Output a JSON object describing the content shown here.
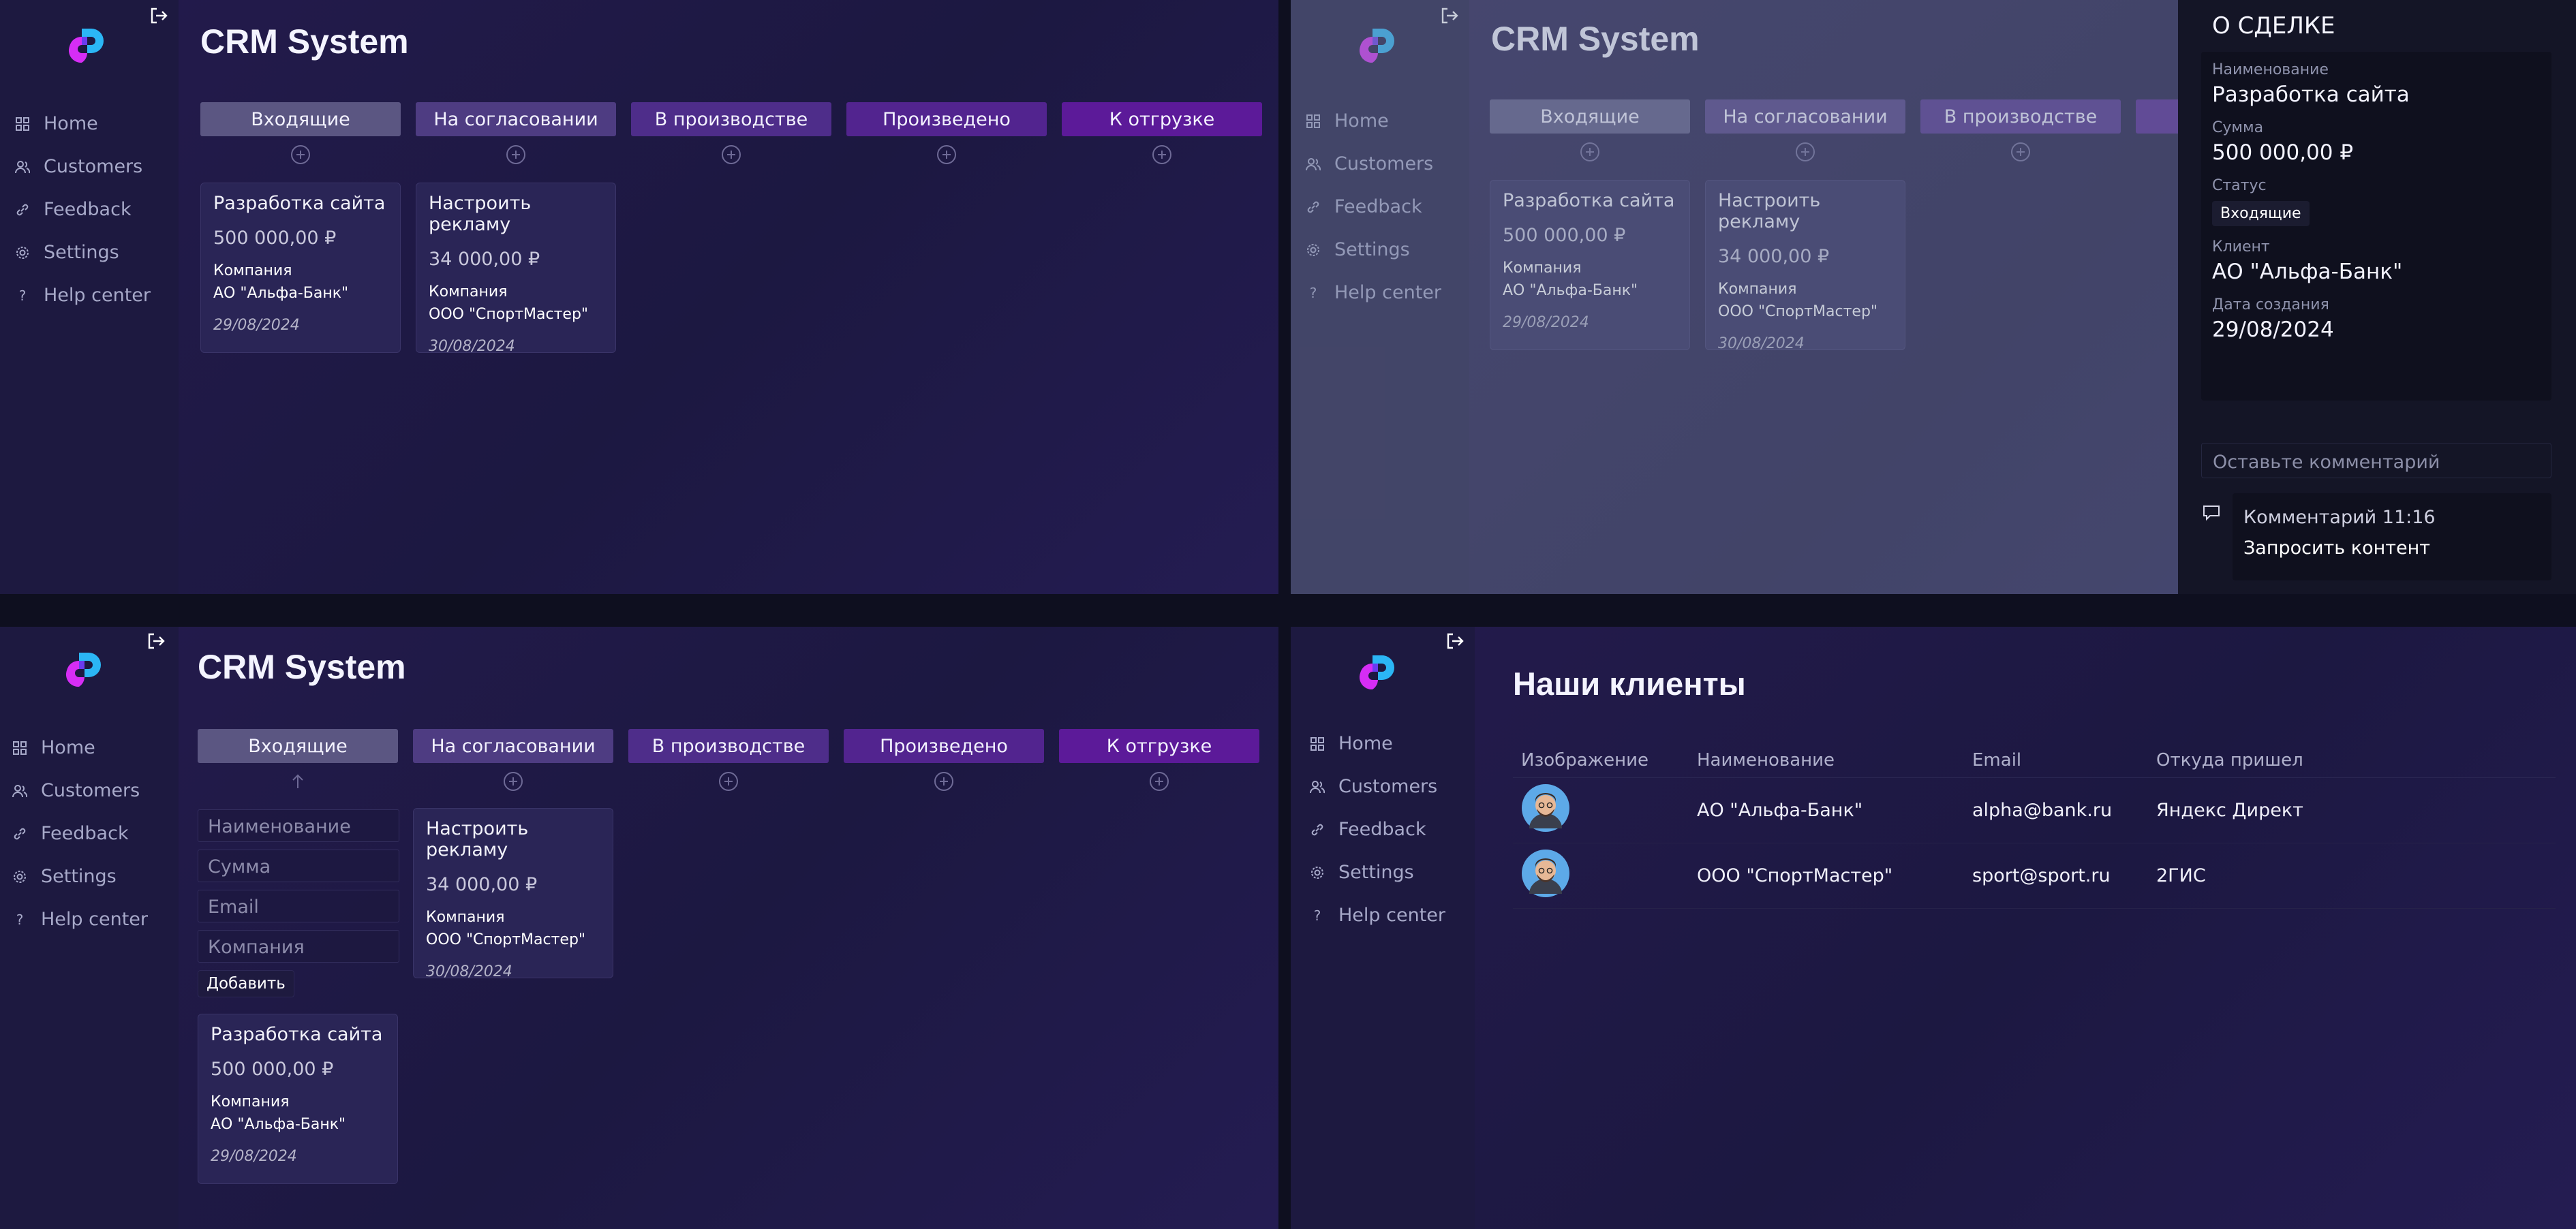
{
  "app": {
    "title": "CRM System",
    "nav": [
      {
        "label": "Home",
        "icon": "grid-icon"
      },
      {
        "label": "Customers",
        "icon": "users-icon"
      },
      {
        "label": "Feedback",
        "icon": "link-icon"
      },
      {
        "label": "Settings",
        "icon": "gear-icon"
      },
      {
        "label": "Help center",
        "icon": "question-icon"
      }
    ]
  },
  "board": {
    "columns": [
      {
        "label": "Входящие",
        "color": "#5b5682"
      },
      {
        "label": "На согласовании",
        "color": "#4e3c82"
      },
      {
        "label": "В производстве",
        "color": "#4e2d8a"
      },
      {
        "label": "Произведено",
        "color": "#52248f"
      },
      {
        "label": "К отгрузке",
        "color": "#5c1a99"
      }
    ],
    "deals": [
      {
        "title": "Разработка сайта",
        "sum": "500 000,00 ₽",
        "company_label": "Компания",
        "company": "АО \"Альфа-Банк\"",
        "date": "29/08/2024"
      },
      {
        "title": "Настроить рекламу",
        "sum": "34 000,00 ₽",
        "company_label": "Компания",
        "company": "ООО \"СпортМастер\"",
        "date": "30/08/2024"
      }
    ]
  },
  "drawer": {
    "title": "О СДЕЛКЕ",
    "name_label": "Наименование",
    "name": "Разработка сайта",
    "sum_label": "Сумма",
    "sum": "500 000,00 ₽",
    "status_label": "Статус",
    "status": "Входящие",
    "client_label": "Клиент",
    "client": "АО \"Альфа-Банк\"",
    "created_label": "Дата создания",
    "created": "29/08/2024",
    "comment_placeholder": "Оставьте комментарий",
    "comment_time": "Комментарий 11:16",
    "comment_text": "Запросить контент"
  },
  "form": {
    "name_placeholder": "Наименование",
    "sum_placeholder": "Сумма",
    "email_placeholder": "Email",
    "company_placeholder": "Компания",
    "submit_label": "Добавить"
  },
  "customers": {
    "title": "Наши клиенты",
    "headers": [
      "Изображение",
      "Наименование",
      "Email",
      "Откуда пришел"
    ],
    "rows": [
      {
        "name": "АО \"Альфа-Банк\"",
        "email": "alpha@bank.ru",
        "source": "Яндекс Директ"
      },
      {
        "name": "ООО \"СпортМастер\"",
        "email": "sport@sport.ru",
        "source": "2ГИС"
      }
    ]
  },
  "colors": {
    "accent_pink": "#d62df5",
    "accent_blue": "#2bb6f5",
    "background": "#1c1841"
  }
}
